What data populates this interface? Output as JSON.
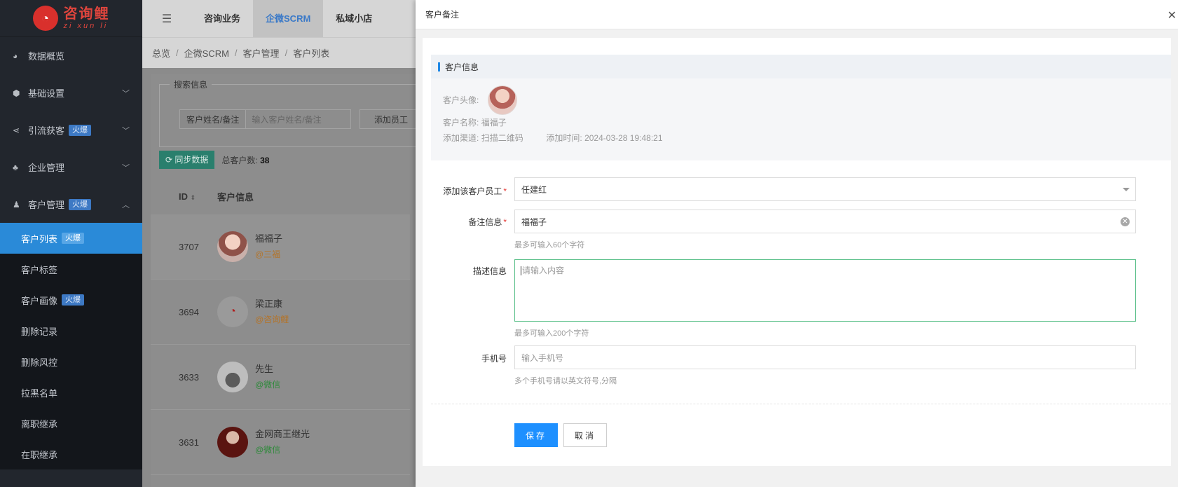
{
  "sidebar": {
    "logo": {
      "cn": "咨询鲤",
      "pinyin": "zi xun li"
    },
    "menu": [
      {
        "label": "数据概览",
        "icon": "pie-icon"
      },
      {
        "label": "基础设置",
        "icon": "cube-icon"
      },
      {
        "label": "引流获客",
        "icon": "share-icon",
        "badge": "火爆"
      },
      {
        "label": "企业管理",
        "icon": "org-icon"
      },
      {
        "label": "客户管理",
        "icon": "user-icon",
        "badge": "火爆"
      }
    ],
    "submenu": [
      {
        "label": "客户列表",
        "badge": "火爆",
        "active": true
      },
      {
        "label": "客户标签"
      },
      {
        "label": "客户画像",
        "badge": "火爆"
      },
      {
        "label": "删除记录"
      },
      {
        "label": "删除风控"
      },
      {
        "label": "拉黑名单"
      },
      {
        "label": "离职继承"
      },
      {
        "label": "在职继承"
      }
    ]
  },
  "topbar": {
    "tabs": [
      "咨询业务",
      "企微SCRM",
      "私域小店"
    ],
    "active_tab": "企微SCRM"
  },
  "breadcrumb": [
    "总览",
    "企微SCRM",
    "客户管理",
    "客户列表"
  ],
  "search": {
    "legend": "搜索信息",
    "name_label": "客户姓名/备注",
    "name_placeholder": "输入客户姓名/备注",
    "staff_label": "添加员工"
  },
  "list": {
    "sync_label": "同步数据",
    "total_label": "总客户数:",
    "total_value": "38",
    "columns": [
      "ID",
      "客户信息"
    ],
    "rows": [
      {
        "id": "3707",
        "name": "福福子",
        "tag": "@三福"
      },
      {
        "id": "3694",
        "name": "梁正康",
        "tag": "@咨询鲤"
      },
      {
        "id": "3633",
        "name": "先生",
        "tag": "@微信"
      },
      {
        "id": "3631",
        "name": "金网商王继光",
        "tag": "@微信"
      }
    ]
  },
  "drawer": {
    "title": "客户备注",
    "info_title": "客户信息",
    "avatar_label": "客户头像:",
    "name_label": "客户名称:",
    "name_value": "福福子",
    "channel_label": "添加渠道:",
    "channel_value": "扫描二维码",
    "time_label": "添加时间:",
    "time_value": "2024-03-28 19:48:21",
    "staff_label": "添加该客户员工",
    "staff_value": "任建红",
    "remark_label": "备注信息",
    "remark_value": "福福子",
    "remark_hint": "最多可输入60个字符",
    "desc_label": "描述信息",
    "desc_placeholder": "请输入内容",
    "desc_hint": "最多可输入200个字符",
    "phone_label": "手机号",
    "phone_placeholder": "输入手机号",
    "phone_hint": "多个手机号请以英文符号,分隔",
    "save_label": "保存",
    "cancel_label": "取消"
  }
}
